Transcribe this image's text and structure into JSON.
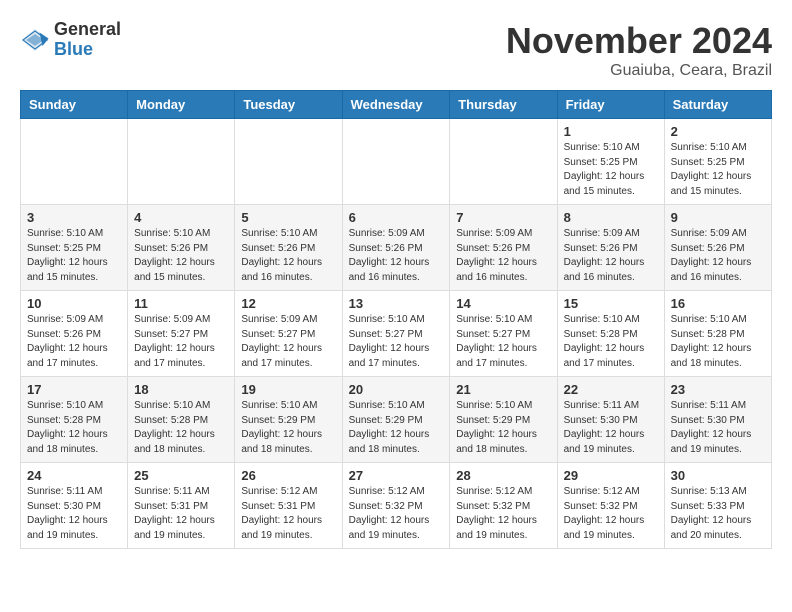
{
  "header": {
    "logo_general": "General",
    "logo_blue": "Blue",
    "month_year": "November 2024",
    "location": "Guaiuba, Ceara, Brazil"
  },
  "weekdays": [
    "Sunday",
    "Monday",
    "Tuesday",
    "Wednesday",
    "Thursday",
    "Friday",
    "Saturday"
  ],
  "weeks": [
    [
      {
        "day": "",
        "info": ""
      },
      {
        "day": "",
        "info": ""
      },
      {
        "day": "",
        "info": ""
      },
      {
        "day": "",
        "info": ""
      },
      {
        "day": "",
        "info": ""
      },
      {
        "day": "1",
        "info": "Sunrise: 5:10 AM\nSunset: 5:25 PM\nDaylight: 12 hours\nand 15 minutes."
      },
      {
        "day": "2",
        "info": "Sunrise: 5:10 AM\nSunset: 5:25 PM\nDaylight: 12 hours\nand 15 minutes."
      }
    ],
    [
      {
        "day": "3",
        "info": "Sunrise: 5:10 AM\nSunset: 5:25 PM\nDaylight: 12 hours\nand 15 minutes."
      },
      {
        "day": "4",
        "info": "Sunrise: 5:10 AM\nSunset: 5:26 PM\nDaylight: 12 hours\nand 15 minutes."
      },
      {
        "day": "5",
        "info": "Sunrise: 5:10 AM\nSunset: 5:26 PM\nDaylight: 12 hours\nand 16 minutes."
      },
      {
        "day": "6",
        "info": "Sunrise: 5:09 AM\nSunset: 5:26 PM\nDaylight: 12 hours\nand 16 minutes."
      },
      {
        "day": "7",
        "info": "Sunrise: 5:09 AM\nSunset: 5:26 PM\nDaylight: 12 hours\nand 16 minutes."
      },
      {
        "day": "8",
        "info": "Sunrise: 5:09 AM\nSunset: 5:26 PM\nDaylight: 12 hours\nand 16 minutes."
      },
      {
        "day": "9",
        "info": "Sunrise: 5:09 AM\nSunset: 5:26 PM\nDaylight: 12 hours\nand 16 minutes."
      }
    ],
    [
      {
        "day": "10",
        "info": "Sunrise: 5:09 AM\nSunset: 5:26 PM\nDaylight: 12 hours\nand 17 minutes."
      },
      {
        "day": "11",
        "info": "Sunrise: 5:09 AM\nSunset: 5:27 PM\nDaylight: 12 hours\nand 17 minutes."
      },
      {
        "day": "12",
        "info": "Sunrise: 5:09 AM\nSunset: 5:27 PM\nDaylight: 12 hours\nand 17 minutes."
      },
      {
        "day": "13",
        "info": "Sunrise: 5:10 AM\nSunset: 5:27 PM\nDaylight: 12 hours\nand 17 minutes."
      },
      {
        "day": "14",
        "info": "Sunrise: 5:10 AM\nSunset: 5:27 PM\nDaylight: 12 hours\nand 17 minutes."
      },
      {
        "day": "15",
        "info": "Sunrise: 5:10 AM\nSunset: 5:28 PM\nDaylight: 12 hours\nand 17 minutes."
      },
      {
        "day": "16",
        "info": "Sunrise: 5:10 AM\nSunset: 5:28 PM\nDaylight: 12 hours\nand 18 minutes."
      }
    ],
    [
      {
        "day": "17",
        "info": "Sunrise: 5:10 AM\nSunset: 5:28 PM\nDaylight: 12 hours\nand 18 minutes."
      },
      {
        "day": "18",
        "info": "Sunrise: 5:10 AM\nSunset: 5:28 PM\nDaylight: 12 hours\nand 18 minutes."
      },
      {
        "day": "19",
        "info": "Sunrise: 5:10 AM\nSunset: 5:29 PM\nDaylight: 12 hours\nand 18 minutes."
      },
      {
        "day": "20",
        "info": "Sunrise: 5:10 AM\nSunset: 5:29 PM\nDaylight: 12 hours\nand 18 minutes."
      },
      {
        "day": "21",
        "info": "Sunrise: 5:10 AM\nSunset: 5:29 PM\nDaylight: 12 hours\nand 18 minutes."
      },
      {
        "day": "22",
        "info": "Sunrise: 5:11 AM\nSunset: 5:30 PM\nDaylight: 12 hours\nand 19 minutes."
      },
      {
        "day": "23",
        "info": "Sunrise: 5:11 AM\nSunset: 5:30 PM\nDaylight: 12 hours\nand 19 minutes."
      }
    ],
    [
      {
        "day": "24",
        "info": "Sunrise: 5:11 AM\nSunset: 5:30 PM\nDaylight: 12 hours\nand 19 minutes."
      },
      {
        "day": "25",
        "info": "Sunrise: 5:11 AM\nSunset: 5:31 PM\nDaylight: 12 hours\nand 19 minutes."
      },
      {
        "day": "26",
        "info": "Sunrise: 5:12 AM\nSunset: 5:31 PM\nDaylight: 12 hours\nand 19 minutes."
      },
      {
        "day": "27",
        "info": "Sunrise: 5:12 AM\nSunset: 5:32 PM\nDaylight: 12 hours\nand 19 minutes."
      },
      {
        "day": "28",
        "info": "Sunrise: 5:12 AM\nSunset: 5:32 PM\nDaylight: 12 hours\nand 19 minutes."
      },
      {
        "day": "29",
        "info": "Sunrise: 5:12 AM\nSunset: 5:32 PM\nDaylight: 12 hours\nand 19 minutes."
      },
      {
        "day": "30",
        "info": "Sunrise: 5:13 AM\nSunset: 5:33 PM\nDaylight: 12 hours\nand 20 minutes."
      }
    ]
  ]
}
